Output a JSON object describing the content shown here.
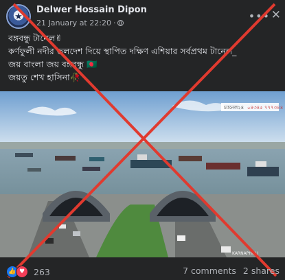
{
  "post": {
    "author": "Delwer Hossain Dipon",
    "timestamp": "21 January at 22:20",
    "separator": "·",
    "caption_lines": [
      "বঙ্গবন্ধু টানেল✌",
      "কর্ণফুলী নদীর তলদেশ দিয়ে স্থাপিত দক্ষিণ এশিয়ার সর্বপ্রথম  টানেল_",
      "জয় বাংলা জয় বঙ্গবন্ধু 🇧🇩",
      "জয়তু শেখ হাসিনা🥀"
    ],
    "image_watermark": "চ্যানেল২৪",
    "image_badge": "০৪৩৪৫ ৭৭৭৩৪৪",
    "image_sign": "KARNAPHULI"
  },
  "footer": {
    "reaction_count": "263",
    "comments": "7 comments",
    "shares": "2 shares"
  },
  "icons": {
    "more": "more-options-icon",
    "close": "close-icon",
    "privacy": "globe-icon",
    "like": "like-reaction-icon",
    "love": "love-reaction-icon"
  },
  "colors": {
    "background": "#242526",
    "cross": "#e03a2f",
    "like": "#1877f2",
    "love": "#f33e58"
  }
}
